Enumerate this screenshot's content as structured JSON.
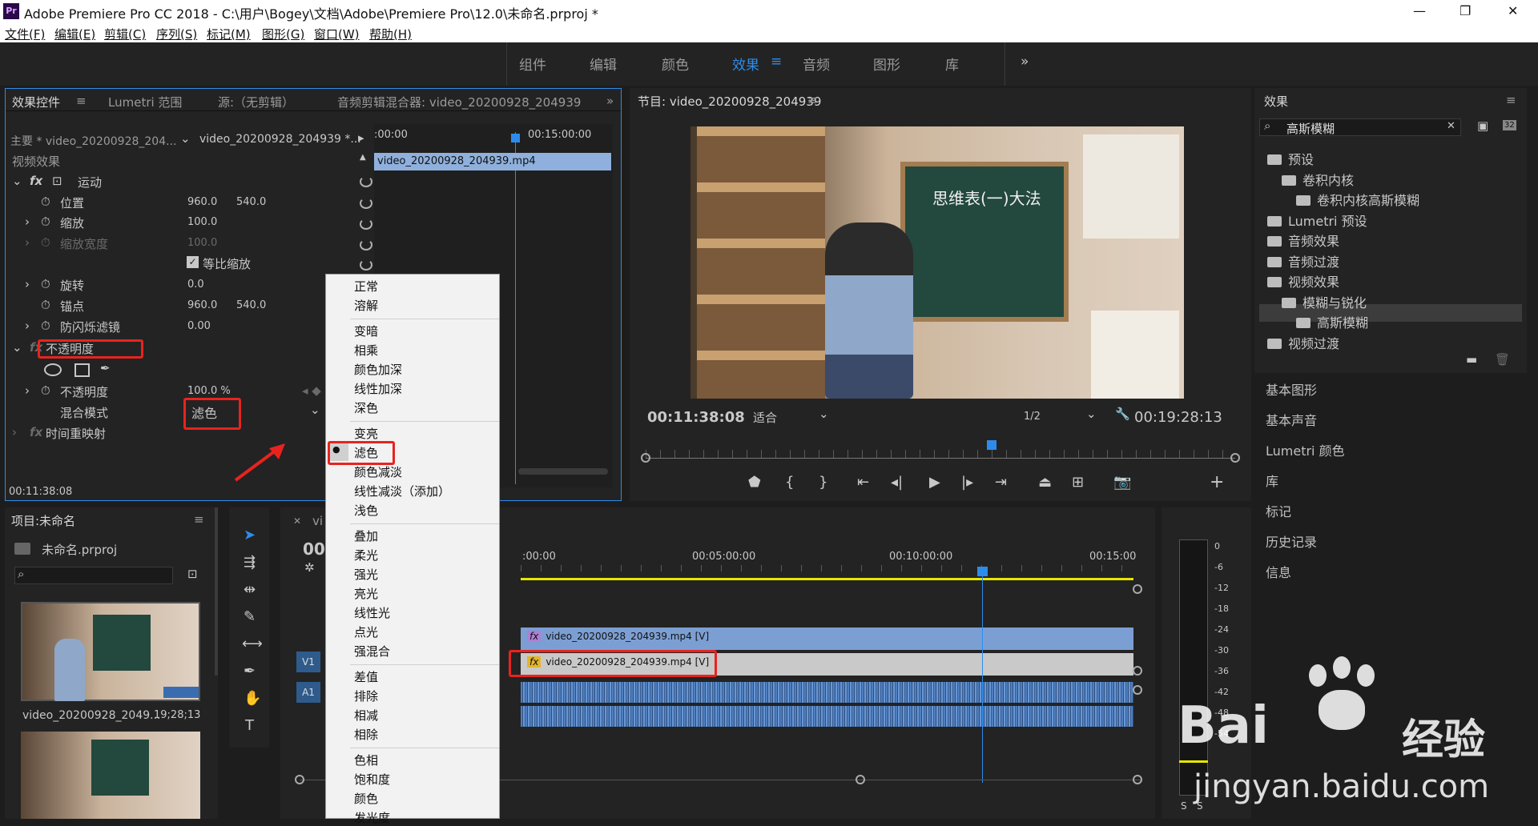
{
  "titlebar": {
    "title": "Adobe Premiere Pro CC 2018 - C:\\用户\\Bogey\\文档\\Adobe\\Premiere Pro\\12.0\\未命名.prproj *",
    "app_icon": "Pr",
    "min": "—",
    "max": "❐",
    "close": "✕"
  },
  "menubar": {
    "items": [
      "文件(F)",
      "编辑(E)",
      "剪辑(C)",
      "序列(S)",
      "标记(M)",
      "图形(G)",
      "窗口(W)",
      "帮助(H)"
    ]
  },
  "workspaces": {
    "items": [
      "组件",
      "编辑",
      "颜色",
      "效果",
      "音频",
      "图形",
      "库"
    ],
    "active": "效果",
    "more": "»"
  },
  "effect_controls": {
    "tabs": [
      "效果控件",
      "Lumetri 范围",
      "源:（无剪辑）",
      "音频剪辑混合器: video_20200928_204939"
    ],
    "master": "主要 * video_20200928_204...",
    "clip": "video_20200928_204939 *...",
    "section": "视频效果",
    "motion": "运动",
    "position_label": "位置",
    "position_x": "960.0",
    "position_y": "540.0",
    "scale_label": "缩放",
    "scale_val": "100.0",
    "scale_width_label": "缩放宽度",
    "scale_width_val": "100.0",
    "uniform_label": "等比缩放",
    "rotation_label": "旋转",
    "rotation_val": "0.0",
    "anchor_label": "锚点",
    "anchor_x": "960.0",
    "anchor_y": "540.0",
    "flicker_label": "防闪烁滤镜",
    "flicker_val": "0.00",
    "opacity_section": "不透明度",
    "opacity_label": "不透明度",
    "opacity_val": "100.0 %",
    "blend_label": "混合模式",
    "blend_val": "滤色",
    "time_remap": "时间重映射",
    "timecode": "00:11:38:08",
    "mini_time_start": ":00:00",
    "mini_time_mid": "00:15:00:00",
    "mini_clip": "video_20200928_204939.mp4"
  },
  "blend_menu": {
    "groups": [
      [
        "正常",
        "溶解"
      ],
      [
        "变暗",
        "相乘",
        "颜色加深",
        "线性加深",
        "深色"
      ],
      [
        "变亮",
        "滤色",
        "颜色减淡",
        "线性减淡（添加）",
        "浅色"
      ],
      [
        "叠加",
        "柔光",
        "强光",
        "亮光",
        "线性光",
        "点光",
        "强混合"
      ],
      [
        "差值",
        "排除",
        "相减",
        "相除"
      ],
      [
        "色相",
        "饱和度",
        "颜色",
        "发光度"
      ]
    ],
    "selected": "滤色"
  },
  "program": {
    "title": "节目: video_20200928_204939",
    "current_time": "00:11:38:08",
    "fit": "适合",
    "quality": "1/2",
    "duration": "00:19:28:13",
    "board_text": "思维表(一)大法"
  },
  "project": {
    "title": "项目:未命名",
    "file": "未命名.prproj",
    "clip1_name": "video_20200928_2049...",
    "clip1_dur": "19;28;13"
  },
  "timeline": {
    "tab": "vi",
    "time": "00:",
    "ruler": [
      ":00:00",
      "00:05:00:00",
      "00:10:00:00",
      "00:15:00"
    ],
    "v2_clip": "video_20200928_204939.mp4 [V]",
    "v1_clip": "video_20200928_204939.mp4 [V]",
    "v1": "V1",
    "a1": "A1"
  },
  "meter": {
    "labels": [
      "0",
      "-6",
      "-12",
      "-18",
      "-24",
      "-30",
      "-36",
      "-42",
      "-48",
      "-54"
    ],
    "solo": "S",
    "sb": "S"
  },
  "effects_panel": {
    "title": "效果",
    "search": "高斯模糊",
    "tree": [
      {
        "label": "预设",
        "indent": 0
      },
      {
        "label": "卷积内核",
        "indent": 1
      },
      {
        "label": "卷积内核高斯模糊",
        "indent": 2
      },
      {
        "label": "Lumetri 预设",
        "indent": 0
      },
      {
        "label": "音频效果",
        "indent": 0
      },
      {
        "label": "音频过渡",
        "indent": 0
      },
      {
        "label": "视频效果",
        "indent": 0
      },
      {
        "label": "模糊与锐化",
        "indent": 1
      },
      {
        "label": "高斯模糊",
        "indent": 2
      },
      {
        "label": "视频过渡",
        "indent": 0
      }
    ]
  },
  "side_panels": [
    "基本图形",
    "基本声音",
    "Lumetri 颜色",
    "库",
    "标记",
    "历史记录",
    "信息"
  ],
  "watermark": {
    "brand": "Bai",
    "brand2": "经验",
    "url": "jingyan.baidu.com"
  },
  "colors": {
    "accent": "#2d8ceb",
    "red": "#e8231f",
    "yellow": "#e6e600"
  }
}
